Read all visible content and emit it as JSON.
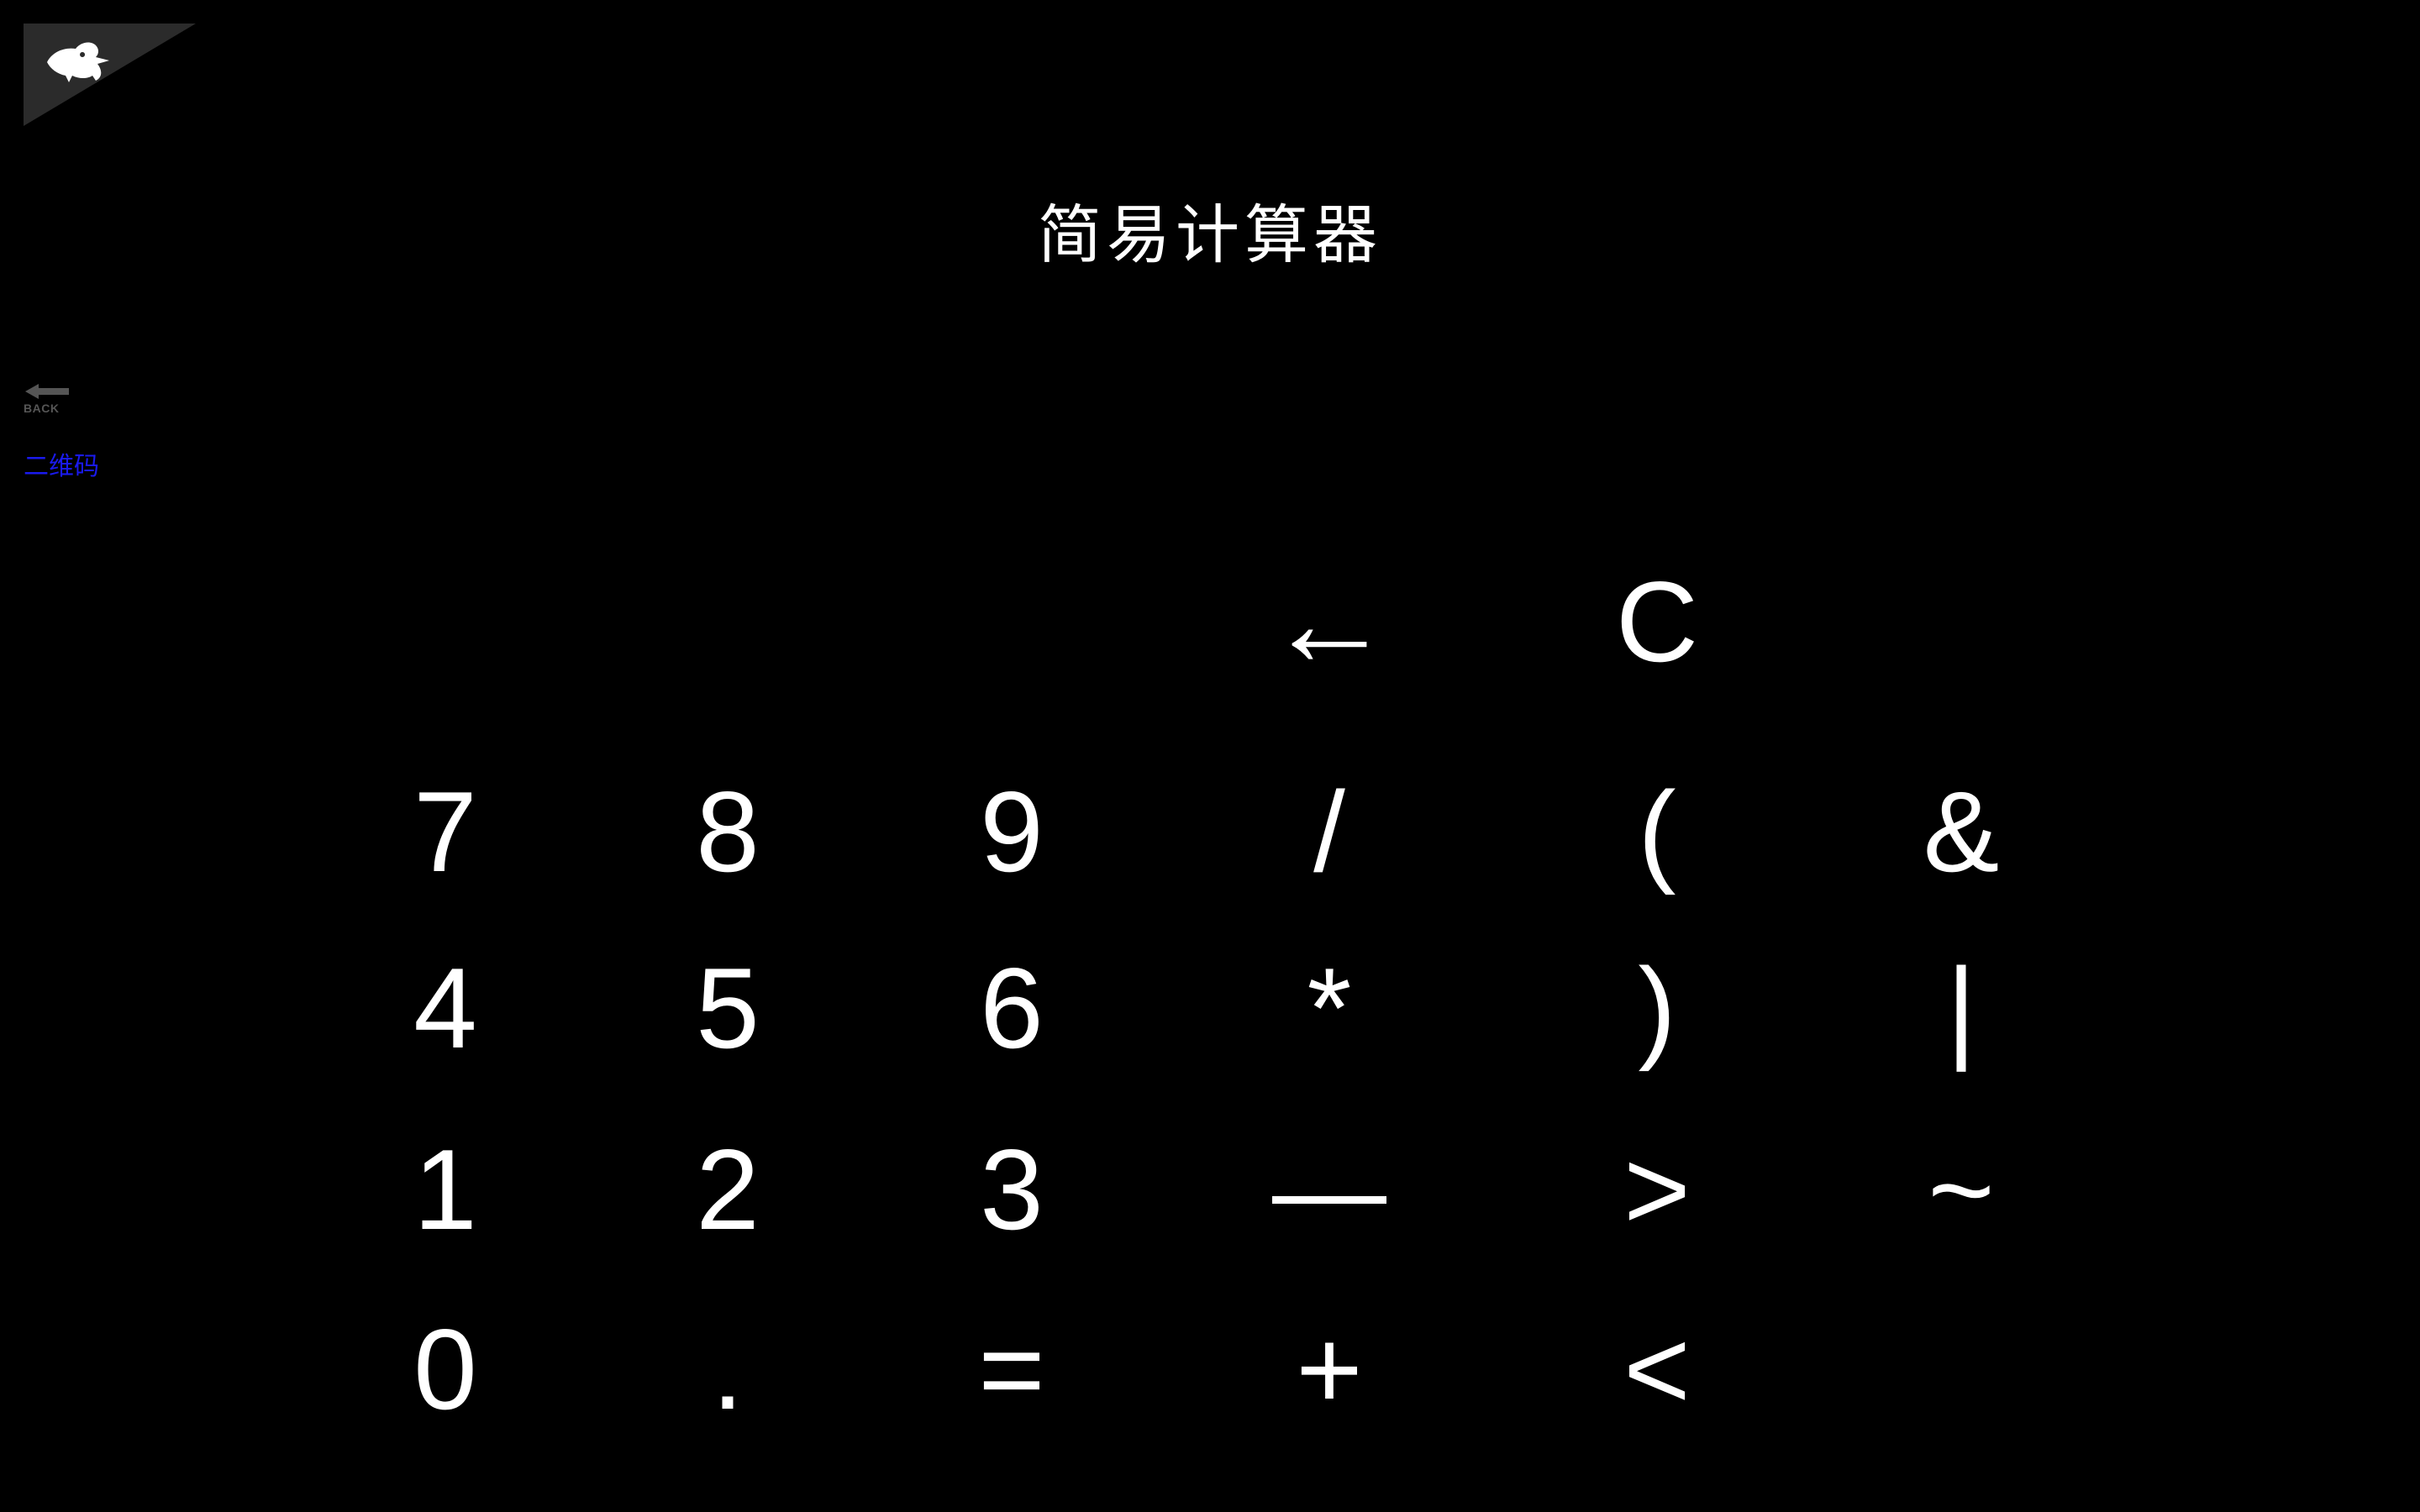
{
  "corner": {
    "logo_icon": "bird-icon"
  },
  "header": {
    "title": "简易计算器"
  },
  "nav": {
    "back_label": "BACK",
    "back_icon": "arrow-left-icon",
    "qr_link": "二维码"
  },
  "keypad": {
    "backspace": "←",
    "clear": "C",
    "row1": [
      "7",
      "8",
      "9",
      "/",
      "(",
      "&"
    ],
    "row2": [
      "4",
      "5",
      "6",
      "*",
      ")",
      "|"
    ],
    "row3": [
      "1",
      "2",
      "3",
      "—",
      ">",
      "~"
    ],
    "row4": [
      "0",
      ".",
      "=",
      "+",
      "<"
    ]
  },
  "colors": {
    "background": "#000000",
    "text": "#ffffff",
    "link": "#1a1aee",
    "corner": "#2b2b2b"
  }
}
